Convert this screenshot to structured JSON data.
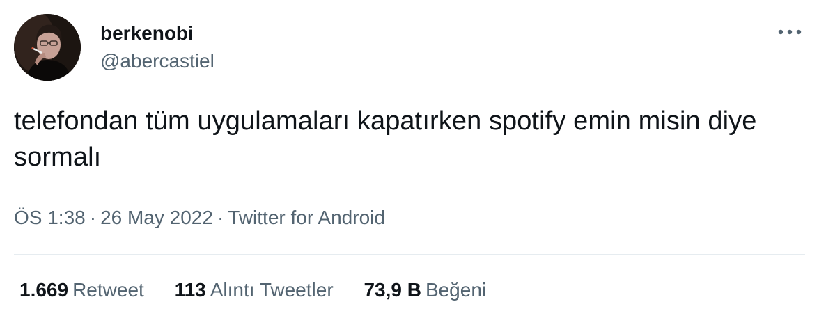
{
  "author": {
    "display_name": "berkenobi",
    "handle": "@abercastiel",
    "avatar_icon": "profile-photo"
  },
  "more_icon": "ellipsis-icon",
  "tweet": {
    "text": "telefondan tüm uygulamaları kapatırken spotify emin misin diye sormalı"
  },
  "meta": {
    "time": "ÖS 1:38",
    "separator": "·",
    "date": "26 May 2022",
    "source": "Twitter for Android"
  },
  "stats": {
    "retweets": {
      "count": "1.669",
      "label": "Retweet"
    },
    "quotes": {
      "count": "113",
      "label": "Alıntı Tweetler"
    },
    "likes": {
      "count": "73,9 B",
      "label": "Beğeni"
    }
  },
  "colors": {
    "text_primary": "#0f1419",
    "text_secondary": "#536471",
    "divider": "#e6ecf0"
  }
}
